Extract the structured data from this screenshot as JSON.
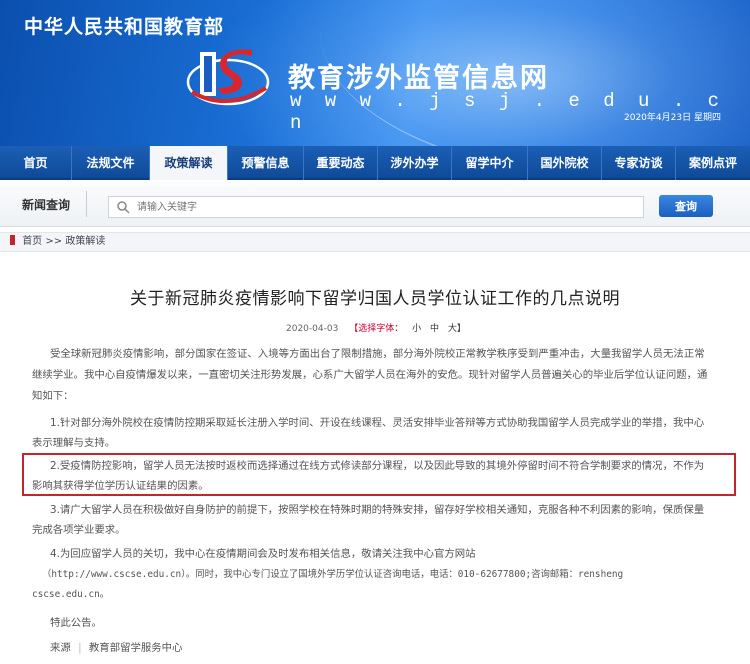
{
  "header": {
    "ministry": "中华人民共和国教育部",
    "site_title": "教育涉外监管信息网",
    "site_url": "w w w . j s j . e d u . c n",
    "date": "2020年4月23日 星期四"
  },
  "nav": {
    "items": [
      {
        "label": "首页"
      },
      {
        "label": "法规文件"
      },
      {
        "label": "政策解读"
      },
      {
        "label": "预警信息"
      },
      {
        "label": "重要动态"
      },
      {
        "label": "涉外办学"
      },
      {
        "label": "留学中介"
      },
      {
        "label": "国外院校"
      },
      {
        "label": "专家访谈"
      },
      {
        "label": "案例点评"
      }
    ],
    "active_index": 2
  },
  "search": {
    "label": "新闻查询",
    "placeholder": "请输入关键字",
    "button": "查询"
  },
  "breadcrumb": {
    "home": "首页",
    "sep": ">>",
    "current": "政策解读"
  },
  "article": {
    "title": "关于新冠肺炎疫情影响下留学归国人员学位认证工作的几点说明",
    "date": "2020-04-03",
    "font_label": "【选择字体：",
    "font_small": "小",
    "font_medium": "中",
    "font_large": "大】",
    "p1_l1": "受全球新冠肺炎疫情影响，部分国家在签证、入境等方面出台了限制措施，部分海外院校正常教学秩序受到严重冲击，大量我留学人员无法正常",
    "p1_l2": "继续学业。我中心自疫情爆发以来，一直密切关注形势发展，心系广大留学人员在海外的安危。现针对留学人员普遍关心的毕业后学位认证问题，通",
    "p1_l3": "知如下：",
    "p2_l1": "1.针对部分海外院校在疫情防控期采取延长注册入学时间、开设在线课程、灵活安排毕业答辩等方式协助我国留学人员完成学业的举措，我中心",
    "p2_l2": "表示理解与支持。",
    "p3_l1": "2.受疫情防控影响，留学人员无法按时返校而选择通过在线方式修读部分课程，以及因此导致的其境外停留时间不符合学制要求的情况，不作为",
    "p3_l2": "影响其获得学位学历认证结果的因素。",
    "p4_l1": "3.请广大留学人员在积极做好自身防护的前提下，按照学校在特殊时期的特殊安排，留存好学校相关通知，克服各种不利因素的影响，保质保量",
    "p4_l2": "完成各项学业要求。",
    "p5_l1": "4.为回应留学人员的关切，我中心在疫情期间会及时发布相关信息，敬请关注我中心官方网站",
    "p5_l2": "（http://www.cscse.edu.cn）。同时，我中心专门设立了国境外学历学位认证咨询电话，电话：010-62677800;咨询邮箱：rensheng",
    "p5_l3": "cscse.edu.cn。",
    "p6": "特此公告。",
    "source_label": "来源",
    "source_value": "教育部留学服务中心"
  },
  "colors": {
    "banner": "#1a6fd6",
    "nav": "#1b5fb6",
    "highlight": "#c0262b"
  }
}
